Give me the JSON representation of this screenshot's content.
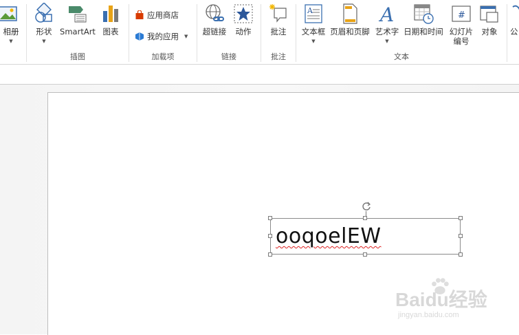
{
  "ribbon": {
    "groups": {
      "images": {
        "album_label": "相册"
      },
      "illustrations": {
        "label": "插图",
        "shapes_label": "形状",
        "smartart_label": "SmartArt",
        "chart_label": "图表"
      },
      "addins": {
        "label": "加载项",
        "store_label": "应用商店",
        "myapps_label": "我的应用"
      },
      "links": {
        "label": "链接",
        "hyperlink_label": "超链接",
        "action_label": "动作"
      },
      "comments": {
        "label": "批注",
        "comment_label": "批注"
      },
      "text": {
        "label": "文本",
        "textbox_label": "文本框",
        "header_footer_label": "页眉和页脚",
        "wordart_label": "艺术字",
        "datetime_label": "日期和时间",
        "slide_number_label_1": "幻灯片",
        "slide_number_label_2": "编号",
        "object_label": "对象"
      },
      "symbols": {
        "label_partial": "公"
      }
    }
  },
  "slide": {
    "textbox_text": "ooqoelEW"
  },
  "watermark": {
    "brand": "Baidu经验",
    "url": "jingyan.baidu.com"
  },
  "colors": {
    "accent_blue": "#2b579a",
    "icon_blue": "#3a6fb0",
    "store_red": "#d83b01"
  }
}
